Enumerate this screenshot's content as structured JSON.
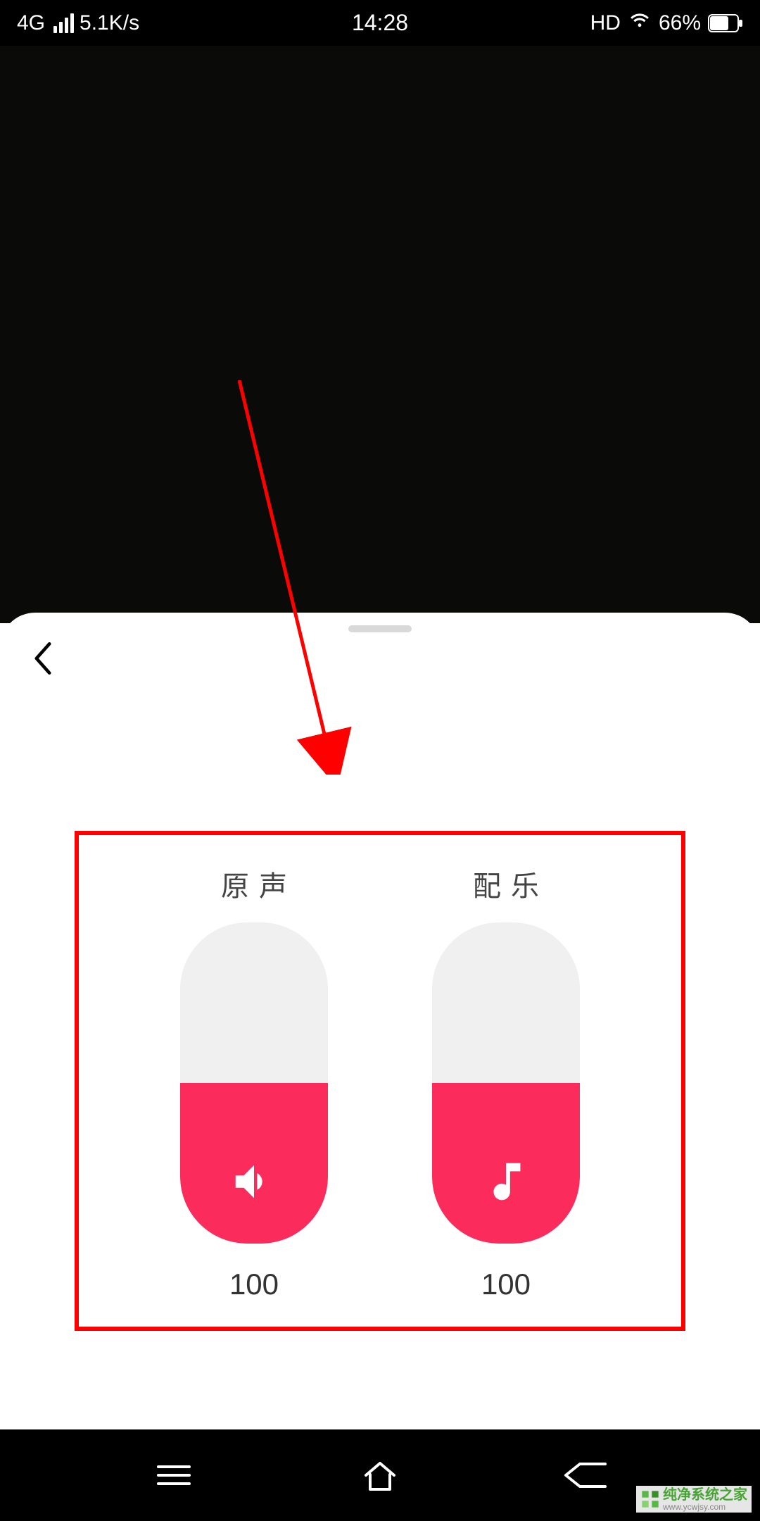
{
  "status": {
    "network": "4G",
    "speed": "5.1K/s",
    "time": "14:28",
    "hd": "HD",
    "battery_pct": "66%"
  },
  "sliders": {
    "original": {
      "label": "原声",
      "value": "100"
    },
    "music": {
      "label": "配乐",
      "value": "100"
    }
  },
  "watermark": {
    "name": "纯净系统之家",
    "url": "www.ycwjsy.com"
  }
}
